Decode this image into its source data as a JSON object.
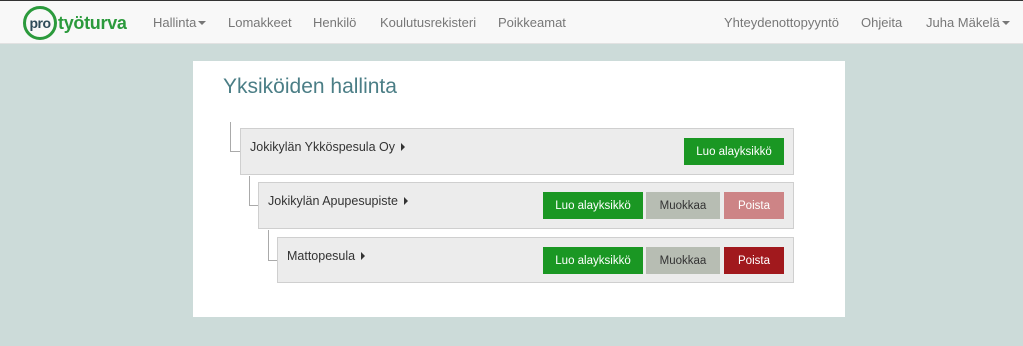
{
  "brand": {
    "prefix": "pro",
    "name": "työturva"
  },
  "nav": {
    "left": [
      {
        "label": "Hallinta",
        "dropdown": true
      },
      {
        "label": "Lomakkeet"
      },
      {
        "label": "Henkilö"
      },
      {
        "label": "Koulutusrekisteri"
      },
      {
        "label": "Poikkeamat"
      }
    ],
    "right": [
      {
        "label": "Yhteydenottopyyntö"
      },
      {
        "label": "Ohjeita"
      },
      {
        "label": "Juha Mäkelä",
        "dropdown": true
      }
    ]
  },
  "page": {
    "title": "Yksiköiden hallinta"
  },
  "units": [
    {
      "name": "Jokikylän Ykköspesula Oy",
      "create_label": "Luo alayksikkö"
    },
    {
      "name": "Jokikylän Apupesupiste",
      "create_label": "Luo alayksikkö",
      "edit_label": "Muokkaa",
      "delete_label": "Poista",
      "delete_enabled": false
    },
    {
      "name": "Mattopesula",
      "create_label": "Luo alayksikkö",
      "edit_label": "Muokkaa",
      "delete_label": "Poista",
      "delete_enabled": true
    }
  ],
  "colors": {
    "brand_green": "#2b9a3c",
    "title": "#4b7e86",
    "button_green": "#1a9723",
    "button_grey": "#b7bdb3",
    "delete_disabled": "#cd8486",
    "delete_enabled": "#a1191d",
    "page_bg": "#ccdbd9"
  }
}
